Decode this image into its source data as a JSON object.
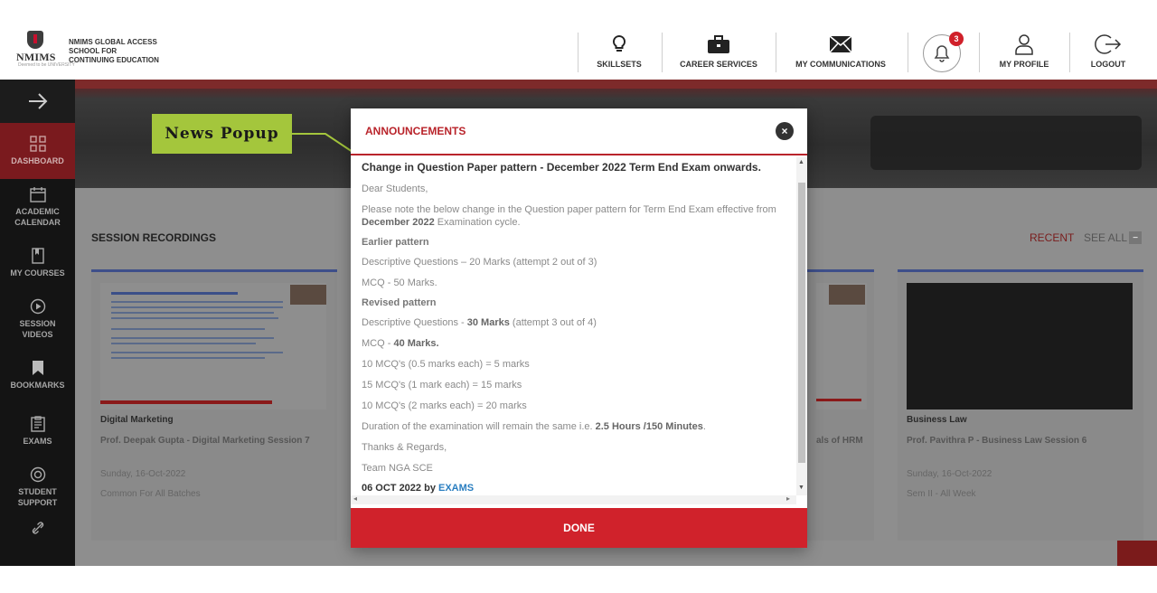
{
  "header": {
    "logo_text": "NMIMS",
    "logo_sub": "Deemed to be UNIVERSITY",
    "school_name": [
      "NMIMS GLOBAL ACCESS",
      "SCHOOL FOR",
      "CONTINUING EDUCATION"
    ],
    "nav": [
      {
        "label": "SKILLSETS",
        "icon": "lightbulb-icon"
      },
      {
        "label": "CAREER SERVICES",
        "icon": "briefcase-icon"
      },
      {
        "label": "MY COMMUNICATIONS",
        "icon": "envelope-icon"
      },
      {
        "label": "MY PROFILE",
        "icon": "user-icon"
      },
      {
        "label": "LOGOUT",
        "icon": "logout-icon"
      }
    ],
    "notification_count": "3"
  },
  "sidebar": {
    "items": [
      {
        "label": "DASHBOARD",
        "icon": "grid-icon"
      },
      {
        "label": "ACADEMIC CALENDAR",
        "icon": "calendar-icon"
      },
      {
        "label": "MY COURSES",
        "icon": "book-icon"
      },
      {
        "label": "SESSION VIDEOS",
        "icon": "play-icon"
      },
      {
        "label": "BOOKMARKS",
        "icon": "bookmark-icon"
      },
      {
        "label": "EXAMS",
        "icon": "exam-icon"
      },
      {
        "label": "STUDENT SUPPORT",
        "icon": "lifebuoy-icon"
      }
    ]
  },
  "main": {
    "section_title": "SESSION RECORDINGS",
    "recent": "RECENT",
    "see_all": "SEE ALL",
    "cards": [
      {
        "title": "Digital Marketing",
        "sub": "Prof. Deepak Gupta - Digital Marketing Session 7",
        "date": "Sunday, 16-Oct-2022",
        "batch": "Common For All Batches"
      },
      {
        "title": "Business Law",
        "sub": "Prof. Pavithra P - Business Law Session 6",
        "date": "Sunday, 16-Oct-2022",
        "batch": "Sem II - All Week"
      }
    ],
    "partial_card_text": "als of HRM"
  },
  "annotation": {
    "label": "News Popup"
  },
  "modal": {
    "title": "ANNOUNCEMENTS",
    "headline": "Change in Question Paper pattern - December 2022 Term End Exam onwards.",
    "greeting": "Dear Students,",
    "intro_a": "Please note the below change in the Question paper pattern for Term End Exam effective from ",
    "intro_bold": "December 2022",
    "intro_b": " Examination cycle.",
    "earlier_title": "Earlier pattern",
    "earlier_desc": "Descriptive Questions – 20 Marks (attempt 2 out of 3)",
    "earlier_mcq": "MCQ - 50 Marks.",
    "revised_title": "Revised pattern",
    "revised_desc_a": "Descriptive Questions - ",
    "revised_desc_bold": "30 Marks",
    "revised_desc_b": " (attempt 3 out of 4)",
    "revised_mcq_a": "MCQ - ",
    "revised_mcq_bold": "40 Marks.",
    "mcq_lines": [
      "10 MCQ's  (0.5 marks each) =  5 marks",
      "15 MCQ's  (1 mark each) =  15 marks",
      "10 MCQ's  (2 marks each) = 20 marks"
    ],
    "duration_a": "Duration of the examination will remain the same i.e. ",
    "duration_bold": "2.5 Hours /150 Minutes",
    "duration_b": ".",
    "thanks": "Thanks & Regards,",
    "team": "Team NGA SCE",
    "footer_date": "06 OCT 2022 by ",
    "footer_link": "EXAMS",
    "done_label": "DONE"
  },
  "colors": {
    "accent": "#d0222b",
    "annotation_green": "#a4c63c",
    "sidebar_bg": "#141414"
  }
}
